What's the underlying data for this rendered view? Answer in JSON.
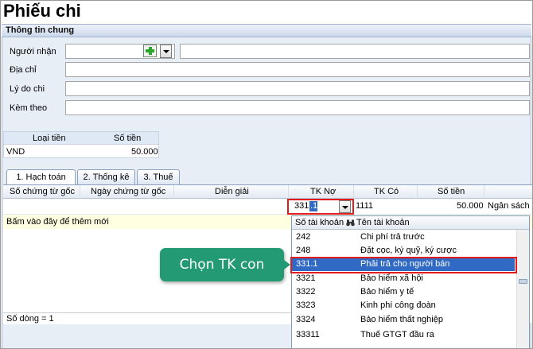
{
  "window": {
    "title": "Phiếu chi"
  },
  "section": {
    "title": "Thông tin chung"
  },
  "form": {
    "recipient_label": "Người nhận",
    "address_label": "Địa chỉ",
    "reason_label": "Lý do chi",
    "attach_label": "Kèm theo"
  },
  "currency": {
    "headers": [
      "Loại tiền",
      "Số tiền"
    ],
    "type": "VND",
    "amount": "50.000"
  },
  "tabs": [
    {
      "label": "1. Hạch toán",
      "active": true
    },
    {
      "label": "2. Thống kê",
      "active": false
    },
    {
      "label": "3. Thuế",
      "active": false
    }
  ],
  "grid": {
    "columns": [
      "Số chứng từ gốc",
      "Ngày chứng từ gốc",
      "Diễn giải",
      "TK Nợ",
      "TK Có",
      "Số tiền",
      "Ngân sách"
    ],
    "row": {
      "tk_no_prefix": "331",
      "tk_no_selected": ".1",
      "tk_co": "1111",
      "amount": "50.000",
      "budget": "Ngân sách"
    },
    "add_row_text": "Bấm vào đây để thêm mới",
    "status_text": "Số dòng = 1"
  },
  "dropdown": {
    "col1": "Số tài khoản",
    "col2": "Tên tài khoản",
    "items": [
      {
        "code": "242",
        "name": "Chi phí trả trước"
      },
      {
        "code": "248",
        "name": "Đặt cọc, ký quỹ, ký cược"
      },
      {
        "code": "331.1",
        "name": "Phải trả cho người bán"
      },
      {
        "code": "3321",
        "name": "Bảo hiểm xã hội"
      },
      {
        "code": "3322",
        "name": "Bảo hiểm y tế"
      },
      {
        "code": "3323",
        "name": "Kinh phí công đoàn"
      },
      {
        "code": "3324",
        "name": "Bảo hiểm thất nghiệp"
      },
      {
        "code": "33311",
        "name": "Thuế GTGT đầu ra"
      }
    ],
    "selected_index": 2
  },
  "callout": {
    "text": "Chọn TK con"
  },
  "colors": {
    "accent": "#316ac5",
    "callout": "#239a74",
    "highlight": "#e21b1b"
  },
  "icons": {
    "add": "plus-icon",
    "dropdown": "chevron-down-icon",
    "search": "binoculars-icon"
  }
}
